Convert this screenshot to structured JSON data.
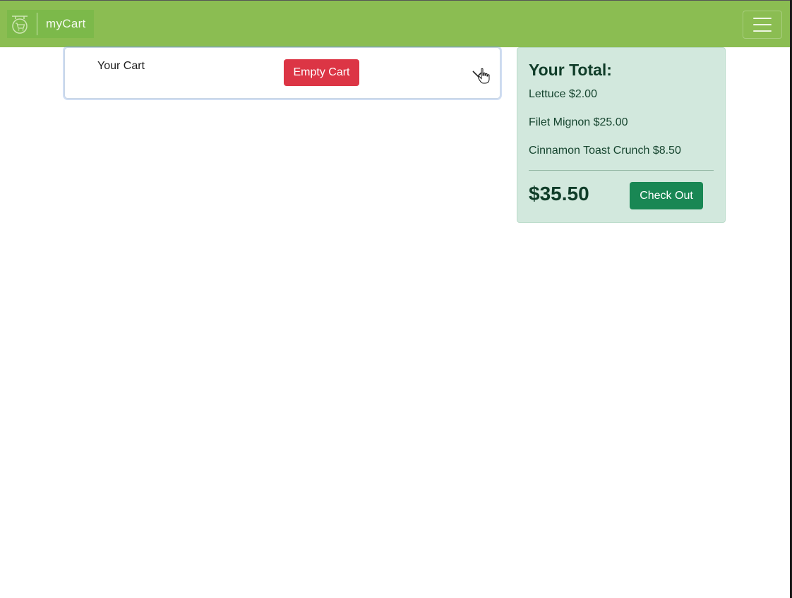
{
  "navbar": {
    "brand_name": "myCart",
    "brand_icon": "cart-logo-icon",
    "menu_icon": "hamburger-menu-icon",
    "background_color": "#8bbd52"
  },
  "cart": {
    "title": "Your Cart",
    "empty_button_label": "Empty Cart",
    "toggle_icon": "chevron-down-icon"
  },
  "totals": {
    "heading": "Your Total:",
    "items": [
      {
        "text": "Lettuce $2.00"
      },
      {
        "text": "Filet Mignon $25.00"
      },
      {
        "text": "Cinnamon Toast Crunch $8.50"
      }
    ],
    "total_amount": "$35.50",
    "checkout_label": "Check Out"
  },
  "colors": {
    "danger": "#dc3545",
    "success": "#198754",
    "total_card_bg": "#d2e8dd"
  }
}
